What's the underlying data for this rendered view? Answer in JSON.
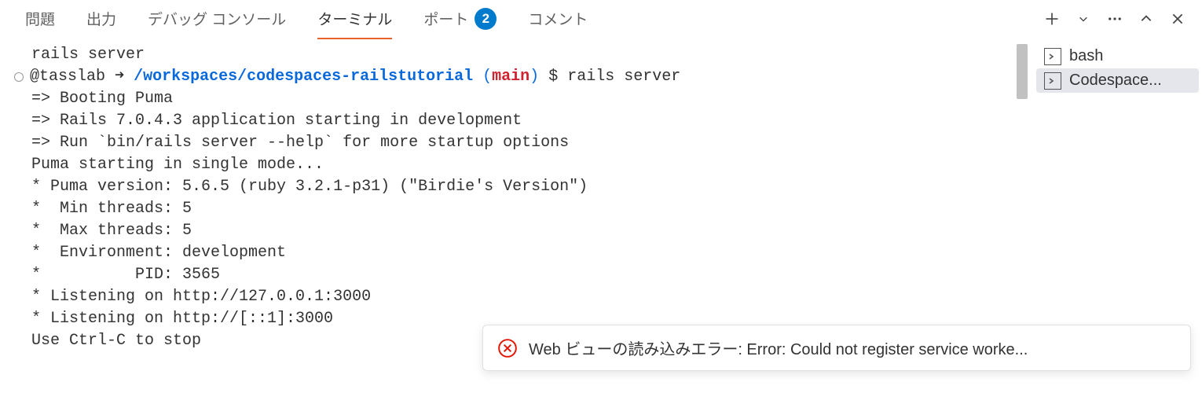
{
  "tabs": {
    "problems": "問題",
    "output": "出力",
    "debugConsole": "デバッグ コンソール",
    "terminal": "ターミナル",
    "ports": "ポート",
    "portsBadge": "2",
    "comments": "コメント"
  },
  "terminal": {
    "line0": "rails server",
    "prompt": {
      "user": "@tasslab",
      "arrow": " ➜ ",
      "path": "/workspaces/codespaces-railstutorial",
      "branchOpen": " (",
      "branch": "main",
      "branchClose": ")",
      "dollar": " $ ",
      "cmd": "rails server"
    },
    "lines": [
      "=> Booting Puma",
      "=> Rails 7.0.4.3 application starting in development ",
      "=> Run `bin/rails server --help` for more startup options",
      "Puma starting in single mode...",
      "* Puma version: 5.6.5 (ruby 3.2.1-p31) (\"Birdie's Version\")",
      "*  Min threads: 5",
      "*  Max threads: 5",
      "*  Environment: development",
      "*          PID: 3565",
      "* Listening on http://127.0.0.1:3000",
      "* Listening on http://[::1]:3000",
      "Use Ctrl-C to stop"
    ]
  },
  "sidebar": {
    "entries": [
      {
        "label": "bash"
      },
      {
        "label": "Codespace..."
      }
    ]
  },
  "notification": {
    "message": "Web ビューの読み込みエラー: Error: Could not register service worke..."
  }
}
